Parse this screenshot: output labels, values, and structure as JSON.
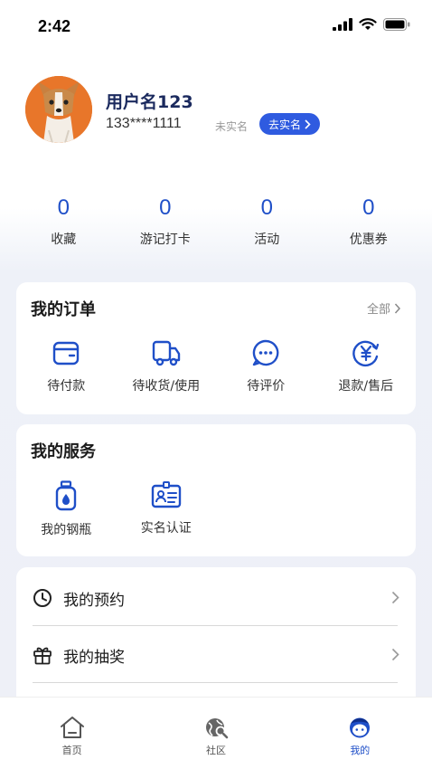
{
  "status_bar": {
    "time": "2:42"
  },
  "profile": {
    "username": "用户名123",
    "phone": "133****1111",
    "verify_status": "未实名",
    "verify_button": "去实名"
  },
  "stats": [
    {
      "value": "0",
      "label": "收藏"
    },
    {
      "value": "0",
      "label": "游记打卡"
    },
    {
      "value": "0",
      "label": "活动"
    },
    {
      "value": "0",
      "label": "优惠券"
    }
  ],
  "orders": {
    "title": "我的订单",
    "more": "全部",
    "items": [
      {
        "label": "待付款",
        "icon": "wallet-icon"
      },
      {
        "label": "待收货/使用",
        "icon": "truck-icon"
      },
      {
        "label": "待评价",
        "icon": "chat-bubble-icon"
      },
      {
        "label": "退款/售后",
        "icon": "yen-refund-icon"
      }
    ]
  },
  "services": {
    "title": "我的服务",
    "items": [
      {
        "label": "我的钢瓶",
        "icon": "gas-cylinder-icon"
      },
      {
        "label": "实名认证",
        "icon": "id-card-icon"
      }
    ]
  },
  "menu": [
    {
      "label": "我的预约",
      "icon": "clock-icon"
    },
    {
      "label": "我的抽奖",
      "icon": "gift-icon"
    }
  ],
  "tabbar": [
    {
      "label": "首页",
      "icon": "home-icon"
    },
    {
      "label": "社区",
      "icon": "community-icon"
    },
    {
      "label": "我的",
      "icon": "mine-face-icon",
      "active": true
    }
  ],
  "colors": {
    "accent": "#1f4fc8",
    "verify_button": "#2f5be0",
    "username": "#1b2a5e"
  }
}
